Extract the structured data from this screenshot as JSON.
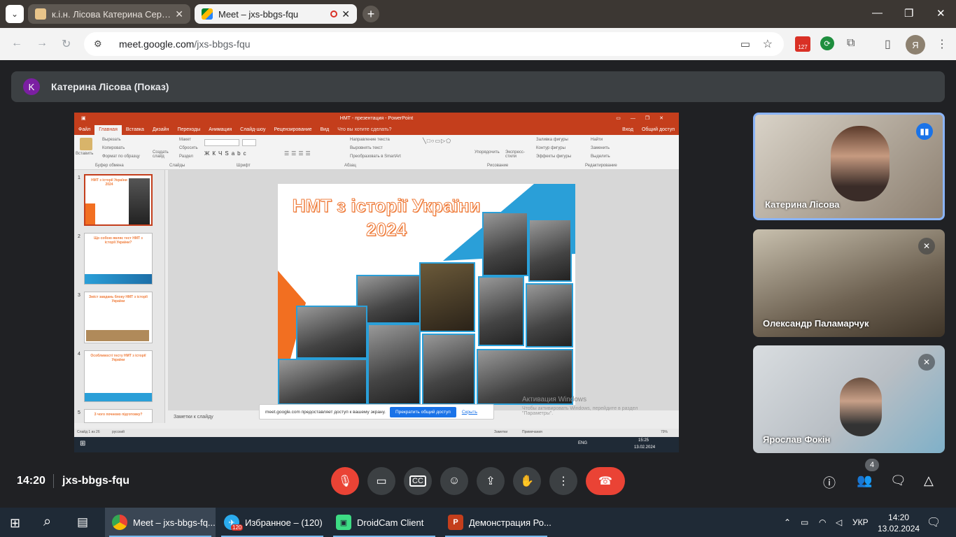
{
  "browser": {
    "tabs": [
      {
        "label": "к.і.н. Лісова Катерина Сергіївна"
      },
      {
        "label": "Meet – jxs-bbgs-fqu"
      }
    ],
    "url_host": "meet.google.com",
    "url_path": "/jxs-bbgs-fqu",
    "extension_badge": "127",
    "profile_initial": "Я"
  },
  "presenter": {
    "initial": "K",
    "name": "Катерина Лісова (Показ)"
  },
  "powerpoint": {
    "window_title": "НМТ - презентация - PowerPoint",
    "menu": [
      "Файл",
      "Главная",
      "Вставка",
      "Дизайн",
      "Переходы",
      "Анимация",
      "Слайд-шоу",
      "Рецензирование",
      "Вид",
      "Что вы хотите сделать?"
    ],
    "login": "Вход",
    "share": "Общий доступ",
    "ribbon_groups": [
      "Буфер обмена",
      "Слайды",
      "Шрифт",
      "Абзац",
      "Рисование",
      "Редактирование"
    ],
    "ribbon_labels": {
      "paste": "Вставить",
      "cut": "Вырезать",
      "copy": "Копировать",
      "format": "Формат по образцу",
      "new_slide": "Создать слайд",
      "layout": "Макет",
      "reset": "Сбросить",
      "section": "Раздел",
      "text_dir": "Направление текста",
      "align_text": "Выровнять текст",
      "smartart": "Преобразовать в SmartArt",
      "arrange": "Упорядочить",
      "quick_styles": "Экспресс-стили",
      "fill": "Заливка фигуры",
      "outline": "Контур фигуры",
      "effects": "Эффекты фигуры",
      "find": "Найти",
      "replace": "Заменить",
      "select": "Выделить"
    },
    "thumb_numbers": [
      "1",
      "2",
      "3",
      "4",
      "5"
    ],
    "thumb_titles": [
      "НМТ з історії України 2024",
      "Що собою являє тест НМТ з історії України?",
      "Зміст завдань блоку НМТ з історії України",
      "Особливості тесту НМТ з історії України",
      "З чого почнемо підготовку?"
    ],
    "slide_title_line1": "НМТ з історії України",
    "slide_title_line2": "2024",
    "notes_placeholder": "Заметки к слайду",
    "status_slide": "Слайд 1 из 26",
    "status_lang": "русский",
    "status_notes": "Заметки",
    "status_comments": "Примечания",
    "zoom": "79%",
    "inner_clock_time": "15:25",
    "inner_clock_date": "13.02.2024",
    "inner_lang": "ENG"
  },
  "share_notice": {
    "text": "meet.google.com предоставляет доступ к вашему экрану.",
    "stop": "Прекратить общий доступ",
    "hide": "Скрыть"
  },
  "activation": {
    "line1": "Активация Windows",
    "line2": "Чтобы активировать Windows, перейдите в раздел \"Параметры\"."
  },
  "participants": [
    {
      "name": "Катерина Лісова",
      "mic": "on"
    },
    {
      "name": "Олександр Паламарчук",
      "mic": "off"
    },
    {
      "name": "Ярослав Фокін",
      "mic": "off"
    }
  ],
  "meeting": {
    "time": "14:20",
    "code": "jxs-bbgs-fqu",
    "people_count": "4"
  },
  "colors": {
    "ppt_red": "#c43e1c",
    "meet_red": "#ea4335",
    "meet_blue": "#1a73e8",
    "slide_orange": "#f26f21",
    "slide_blue": "#2a9fd8"
  },
  "taskbar": {
    "items": [
      {
        "label": "Meet – jxs-bbgs-fq..."
      },
      {
        "label": "Избранное – (120)",
        "badge": "120"
      },
      {
        "label": "DroidCam Client"
      },
      {
        "label": "Демонстрация Ро..."
      }
    ],
    "lang": "УКР",
    "time": "14:20",
    "date": "13.02.2024"
  }
}
